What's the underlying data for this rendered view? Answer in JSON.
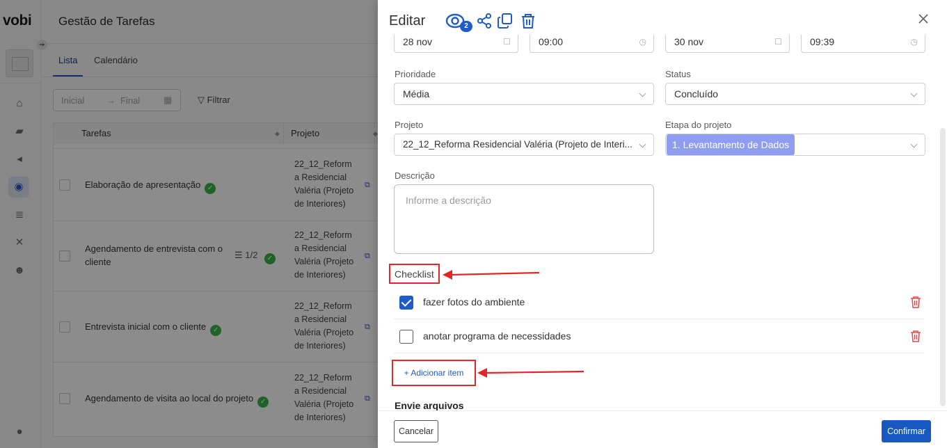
{
  "app": {
    "logo": "vobi",
    "page_title": "Gestão de Tarefas",
    "tabs": [
      "Lista",
      "Calendário"
    ],
    "date_filter": {
      "start_placeholder": "Inicial",
      "end_placeholder": "Final"
    },
    "filter_label": "Filtrar",
    "table": {
      "columns": [
        "Tarefas",
        "Projeto"
      ],
      "rows": [
        {
          "task": "Elaboração de apresentação",
          "project": [
            "22_12_Reform",
            "a Residencial",
            "Valéria (Projeto",
            "de Interiores)"
          ]
        },
        {
          "task": "Agendamento de entrevista com o cliente",
          "subtasks": "1/2",
          "project": [
            "22_12_Reform",
            "a Residencial",
            "Valéria (Projeto",
            "de Interiores)"
          ]
        },
        {
          "task": "Entrevista inicial com o cliente",
          "project": [
            "22_12_Reform",
            "a Residencial",
            "Valéria (Projeto",
            "de Interiores)"
          ]
        },
        {
          "task": "Agendamento de visita ao local do projeto",
          "project": [
            "22_12_Reform",
            "a Residencial",
            "Valéria (Projeto",
            "de Interiores)"
          ]
        }
      ]
    }
  },
  "drawer": {
    "title": "Editar",
    "watchers_count": "2",
    "dates": {
      "start_date": "28 nov",
      "start_time": "09:00",
      "end_date": "30 nov",
      "end_time": "09:39"
    },
    "priority": {
      "label": "Prioridade",
      "value": "Média"
    },
    "status": {
      "label": "Status",
      "value": "Concluído"
    },
    "project": {
      "label": "Projeto",
      "value": "22_12_Reforma Residencial Valéria (Projeto de Interi..."
    },
    "stage": {
      "label": "Etapa do projeto",
      "value": "1. Levantamento de Dados"
    },
    "description": {
      "label": "Descrição",
      "placeholder": "Informe a descrição"
    },
    "checklist": {
      "label": "Checklist",
      "items": [
        {
          "text": "fazer fotos do ambiente",
          "checked": true
        },
        {
          "text": "anotar programa de necessidades",
          "checked": false
        }
      ],
      "add_label": "+ Adicionar item"
    },
    "files_label": "Envie arquivos",
    "cancel_label": "Cancelar",
    "confirm_label": "Confirmar"
  },
  "colors": {
    "primary": "#1f5cc9",
    "annotation": "#e62626",
    "stage_tag": "#8e9df2",
    "delete": "#e04a4a"
  },
  "icons": [
    "eye-icon",
    "share-icon",
    "copy-icon",
    "trash-icon",
    "close-icon",
    "calendar-icon",
    "clock-icon",
    "chevron-down-icon"
  ]
}
